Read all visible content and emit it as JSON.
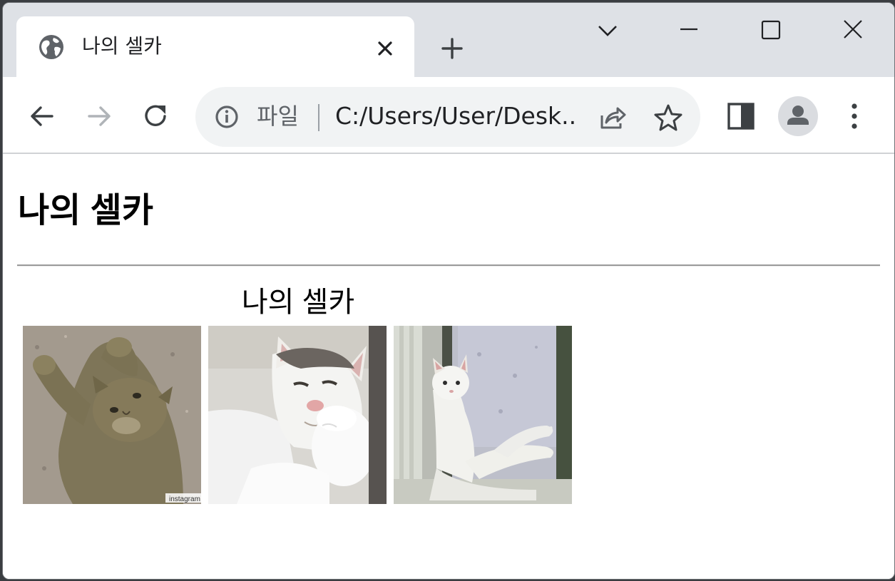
{
  "browser": {
    "tab": {
      "title": "나의 셀카",
      "icon": "globe-icon"
    },
    "omnibox": {
      "scheme_label": "파일",
      "url": "C:/Users/User/Desk..."
    }
  },
  "page": {
    "heading": "나의 셀카",
    "caption": "나의 셀카",
    "images": [
      {
        "description": "tabby-cat-lying-on-back"
      },
      {
        "description": "white-cat-resting-chin-on-paw"
      },
      {
        "description": "white-cat-sitting-by-window"
      }
    ],
    "watermark": "instagram"
  },
  "colors": {
    "titlebar_bg": "#dee1e6",
    "omnibox_bg": "#f1f3f4",
    "icon_color": "#5f6368"
  }
}
